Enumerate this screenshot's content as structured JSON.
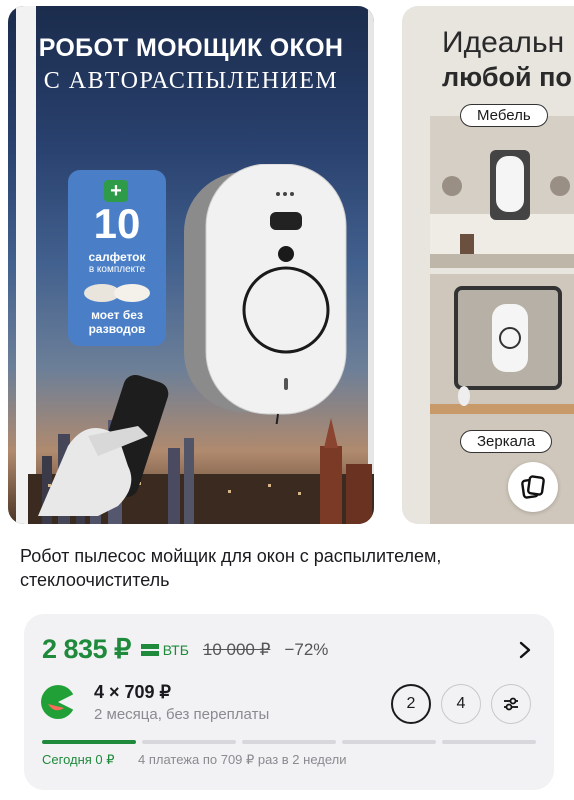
{
  "gallery": {
    "slide1": {
      "title_line1": "РОБОТ МОЮЩИК ОКОН",
      "title_line2": "С АВТОРАСПЫЛЕНИЕМ",
      "badge": {
        "plus": "+",
        "number": "10",
        "line1": "салфеток",
        "line2": "в комплекте",
        "line3": "моет без разводов"
      }
    },
    "slide2": {
      "heading_line1": "Идеальн",
      "heading_line2": "любой по",
      "tag_furniture": "Мебель",
      "tag_mirrors": "Зеркала"
    }
  },
  "product": {
    "title": "Робот пылесос мойщик для окон с распылителем, стеклоочиститель"
  },
  "pricing": {
    "price": "2 835 ₽",
    "bank_label": "ВТБ",
    "old_price": "10 000 ₽",
    "discount": "−72%",
    "installment_amount": "4 × 709 ₽",
    "installment_note": "2 месяца, без переплаты",
    "option_selected": "2",
    "option_other": "4",
    "today_label": "Сегодня 0 ₽",
    "plan_description": "4 платежа по 709 ₽ раз в 2 недели",
    "segments_total": 5,
    "segments_active": 1,
    "accent_color": "#1f8a3c"
  }
}
